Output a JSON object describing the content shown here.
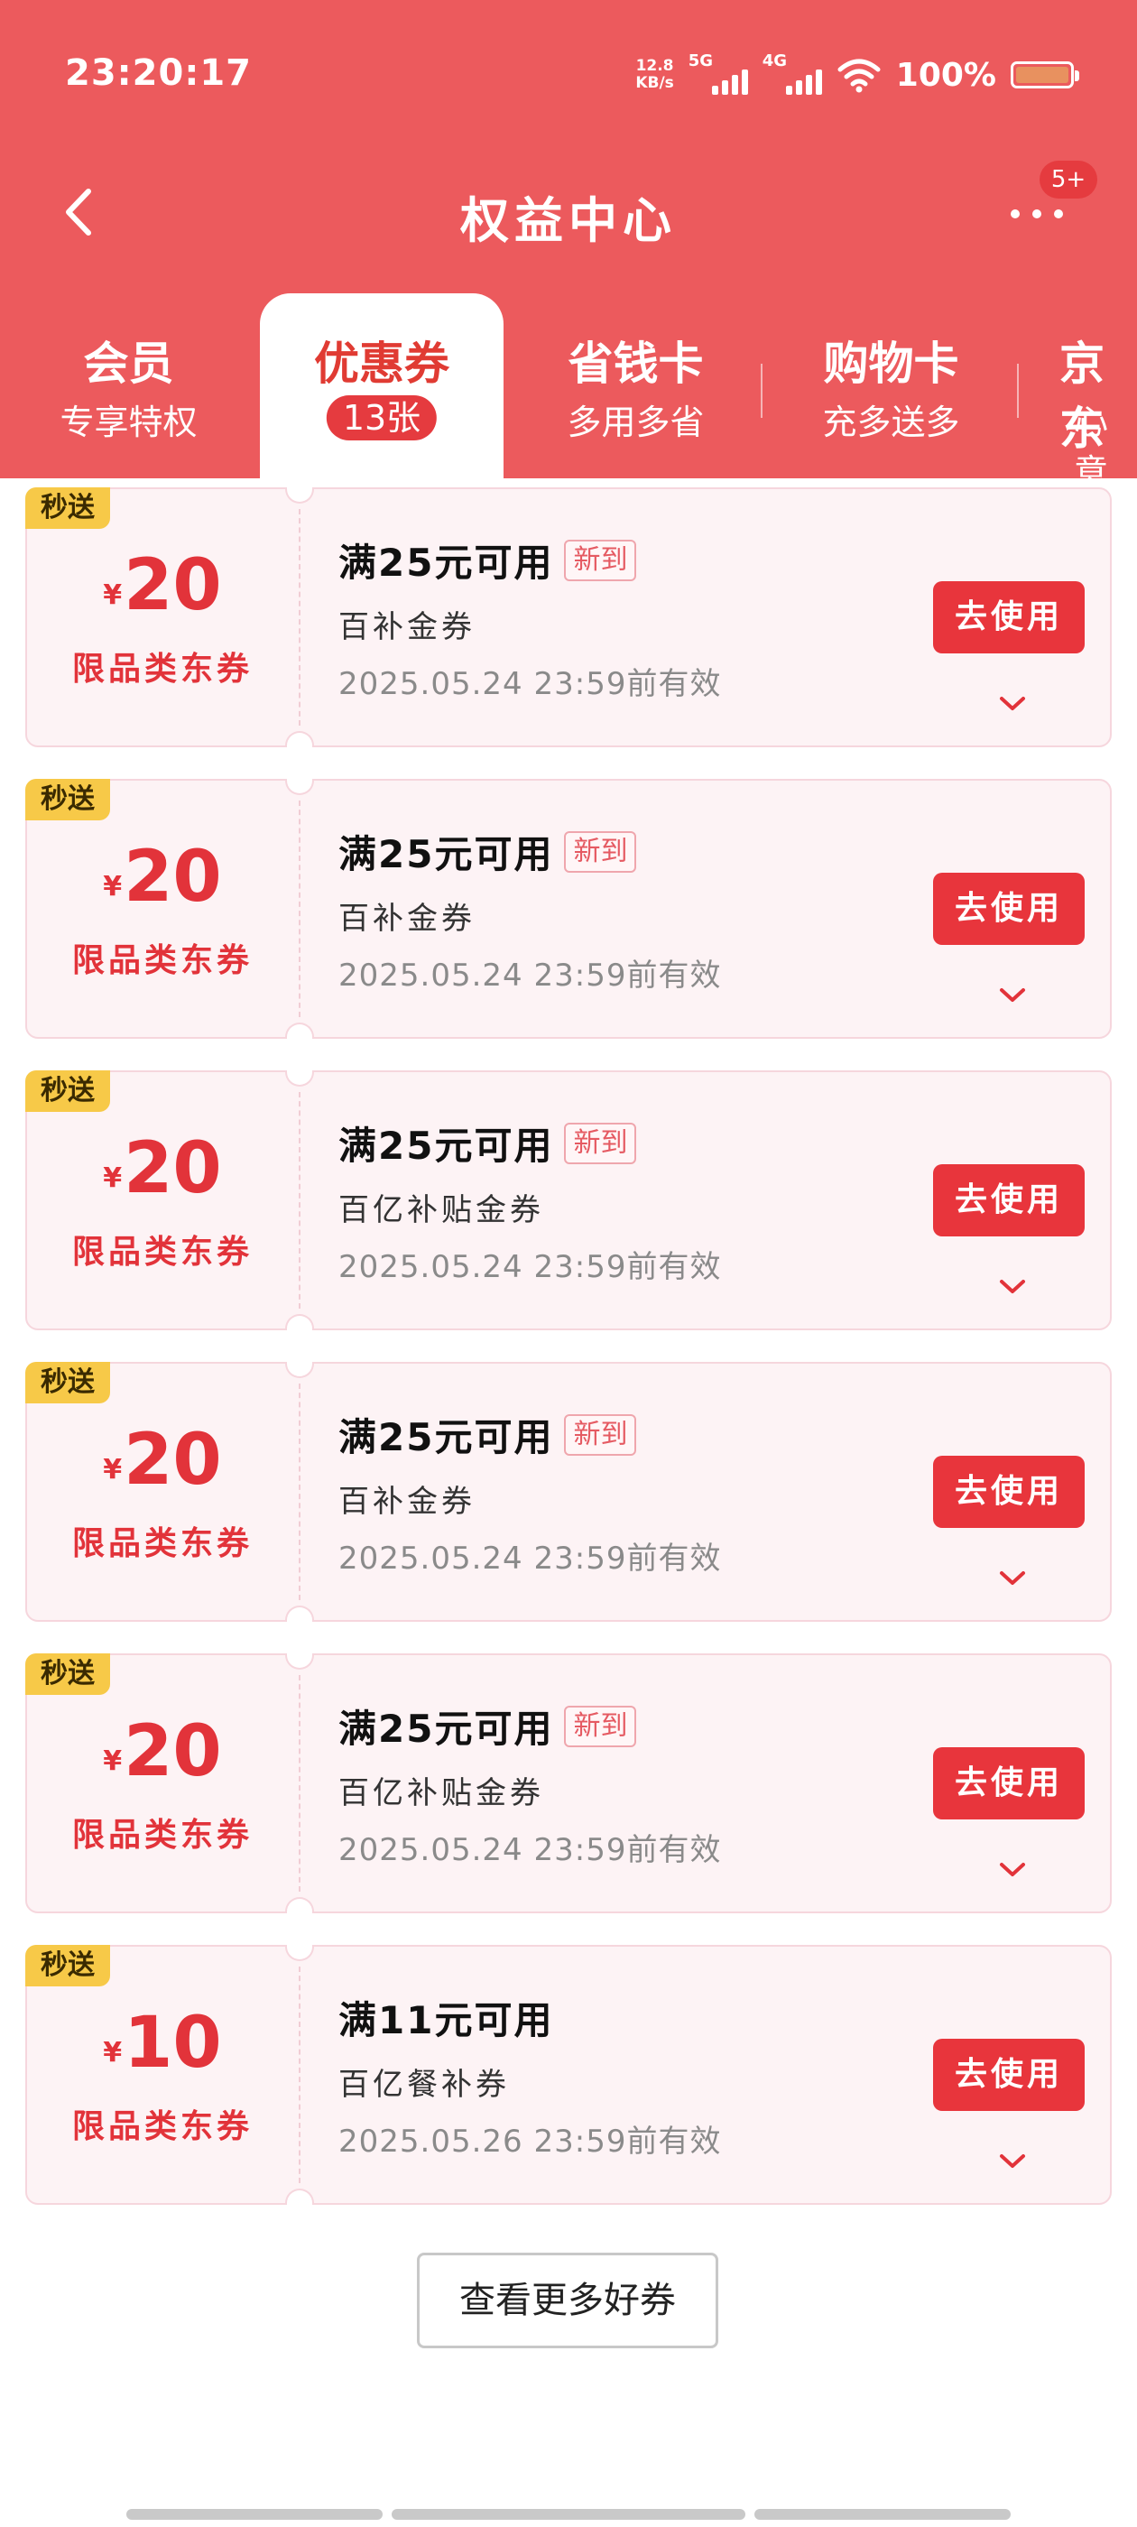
{
  "status_bar": {
    "time": "23:20:17",
    "net_speed_value": "12.8",
    "net_speed_unit": "KB/s",
    "sim1_label": "5G",
    "sim2_label": "4G",
    "battery": "100%"
  },
  "header": {
    "title": "权益中心",
    "badge": "5+"
  },
  "tabs": [
    {
      "title": "会员",
      "subtitle": "专享特权"
    },
    {
      "title": "优惠券",
      "subtitle": "13张"
    },
    {
      "title": "省钱卡",
      "subtitle": "多用多省"
    },
    {
      "title": "购物卡",
      "subtitle": "充多送多"
    },
    {
      "title": "京东",
      "subtitle": "心意"
    }
  ],
  "coupons": [
    {
      "tag": "秒送",
      "currency": "¥",
      "amount": "20",
      "type": "限品类东券",
      "condition": "满25元可用",
      "new_tag": "新到",
      "name": "百补金券",
      "valid": "2025.05.24 23:59前有效",
      "action": "去使用"
    },
    {
      "tag": "秒送",
      "currency": "¥",
      "amount": "20",
      "type": "限品类东券",
      "condition": "满25元可用",
      "new_tag": "新到",
      "name": "百补金券",
      "valid": "2025.05.24 23:59前有效",
      "action": "去使用"
    },
    {
      "tag": "秒送",
      "currency": "¥",
      "amount": "20",
      "type": "限品类东券",
      "condition": "满25元可用",
      "new_tag": "新到",
      "name": "百亿补贴金券",
      "valid": "2025.05.24 23:59前有效",
      "action": "去使用"
    },
    {
      "tag": "秒送",
      "currency": "¥",
      "amount": "20",
      "type": "限品类东券",
      "condition": "满25元可用",
      "new_tag": "新到",
      "name": "百补金券",
      "valid": "2025.05.24 23:59前有效",
      "action": "去使用"
    },
    {
      "tag": "秒送",
      "currency": "¥",
      "amount": "20",
      "type": "限品类东券",
      "condition": "满25元可用",
      "new_tag": "新到",
      "name": "百亿补贴金券",
      "valid": "2025.05.24 23:59前有效",
      "action": "去使用"
    },
    {
      "tag": "秒送",
      "currency": "¥",
      "amount": "10",
      "type": "限品类东券",
      "condition": "满11元可用",
      "name": "百亿餐补券",
      "valid": "2025.05.26 23:59前有效",
      "action": "去使用"
    }
  ],
  "more_button": "查看更多好券",
  "colors": {
    "header_bg": "#ec5a5d",
    "accent_red": "#e8353c",
    "tag_yellow": "#f7c948",
    "coupon_bg": "#fdf3f5"
  }
}
